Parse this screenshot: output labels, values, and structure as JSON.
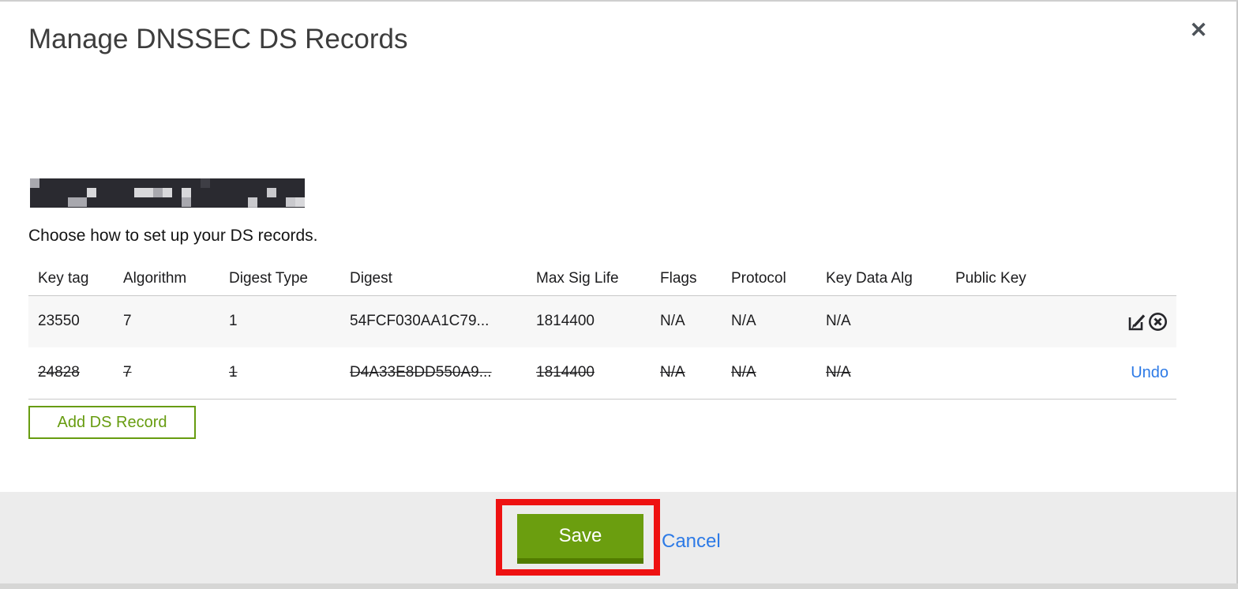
{
  "modal": {
    "title": "Manage DNSSEC DS Records",
    "close_glyph": "✕",
    "domain": "(redacted domain name)",
    "instruction": "Choose how to set up your DS records.",
    "table": {
      "columns": [
        "Key tag",
        "Algorithm",
        "Digest Type",
        "Digest",
        "Max Sig Life",
        "Flags",
        "Protocol",
        "Key Data Alg",
        "Public Key"
      ],
      "rows": [
        {
          "key_tag": "23550",
          "algorithm": "7",
          "digest_type": "1",
          "digest": "54FCF030AA1C79...",
          "max_sig_life": "1814400",
          "flags": "N/A",
          "protocol": "N/A",
          "key_data_alg": "N/A",
          "public_key": "",
          "state": "normal",
          "actions": [
            "edit-icon",
            "remove-icon"
          ]
        },
        {
          "key_tag": "24828",
          "algorithm": "7",
          "digest_type": "1",
          "digest": "D4A33E8DD550A9...",
          "max_sig_life": "1814400",
          "flags": "N/A",
          "protocol": "N/A",
          "key_data_alg": "N/A",
          "public_key": "",
          "state": "marked-for-deletion",
          "undo_label": "Undo"
        }
      ]
    },
    "add_button_label": "Add DS Record",
    "footer": {
      "save_label": "Save",
      "cancel_label": "Cancel"
    },
    "colors": {
      "accent_green": "#6b9e0f",
      "accent_green_dark": "#527c00",
      "link_blue": "#2d7ae6",
      "annotation_red": "#ee1111",
      "row_highlight": "#f7f7f7",
      "footer_gray": "#ececec"
    }
  }
}
